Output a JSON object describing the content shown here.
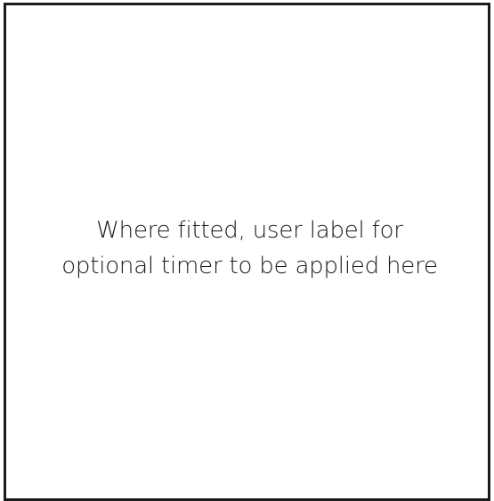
{
  "label": {
    "line_1": "Where fitted, user label for",
    "line_2": "optional timer to be applied here"
  },
  "colors": {
    "border": "#1a1a1a",
    "text": "#1a1a1a",
    "background": "#ffffff"
  }
}
